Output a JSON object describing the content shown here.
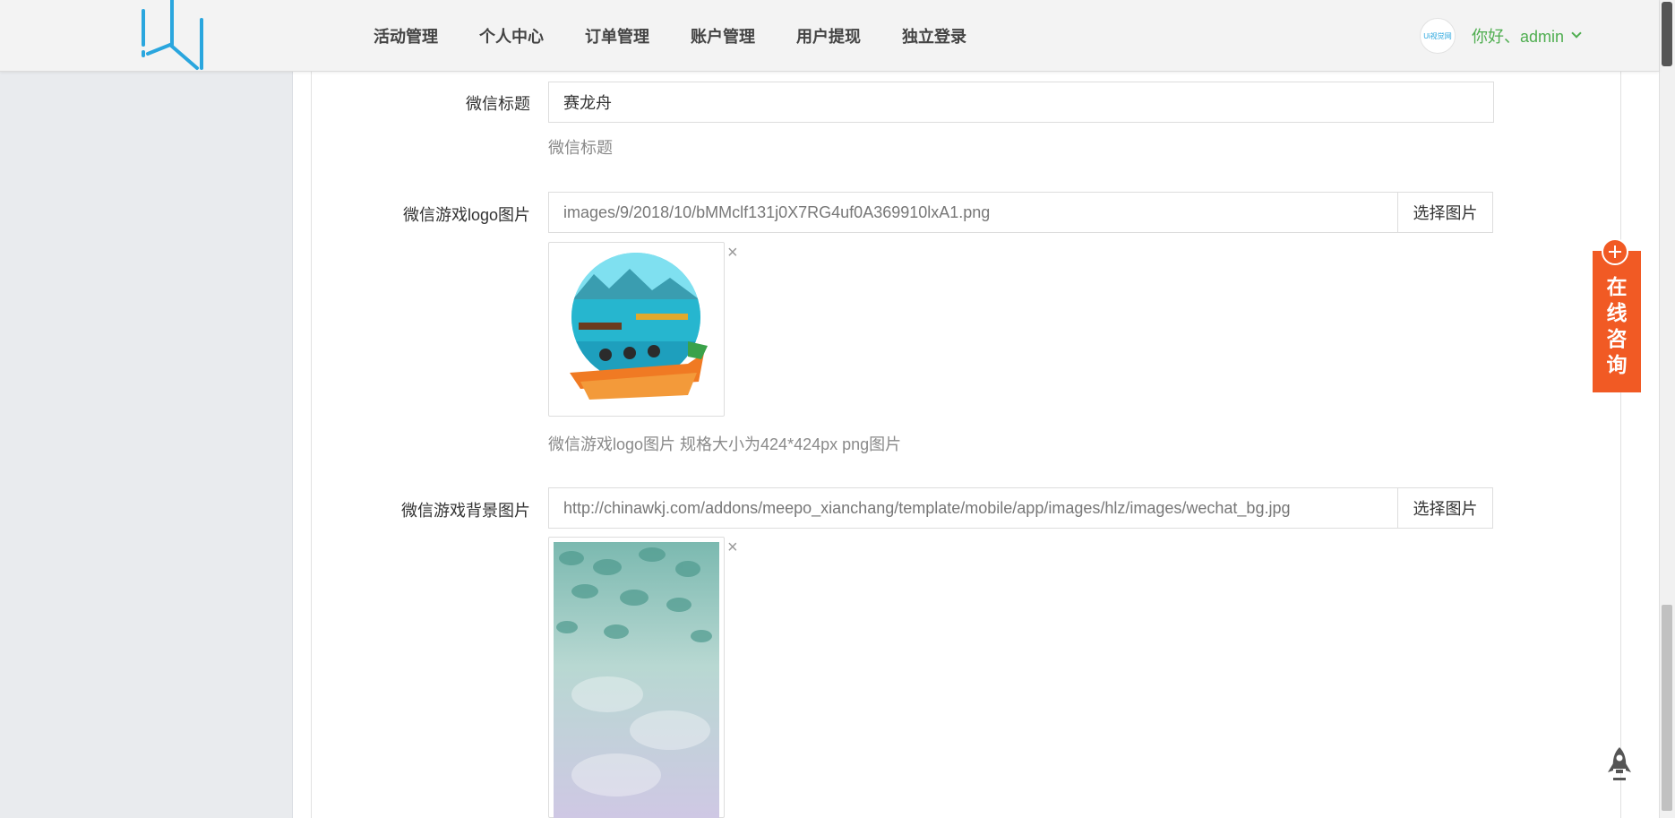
{
  "nav": {
    "items": [
      "活动管理",
      "个人中心",
      "订单管理",
      "账户管理",
      "用户提现",
      "独立登录"
    ]
  },
  "user": {
    "avatar_text": "Ui视觉网",
    "greeting": "你好、admin"
  },
  "form": {
    "title_field": {
      "label": "微信标题",
      "value": "赛龙舟",
      "help": "微信标题"
    },
    "logo_field": {
      "label": "微信游戏logo图片",
      "value": "images/9/2018/10/bMMclf131j0X7RG4uf0A369910lxA1.png",
      "button": "选择图片",
      "remove": "×",
      "help": "微信游戏logo图片 规格大小为424*424px png图片"
    },
    "bg_field": {
      "label": "微信游戏背景图片",
      "value": "http://chinawkj.com/addons/meepo_xianchang/template/mobile/app/images/hlz/images/wechat_bg.jpg",
      "button": "选择图片",
      "remove": "×"
    }
  },
  "consult": {
    "chars": [
      "在",
      "线",
      "咨",
      "询"
    ]
  },
  "colors": {
    "accent": "#2aa6de",
    "greeting": "#4fae50",
    "consult": "#f15a24"
  },
  "icons": [
    "logo-icon",
    "chevron-down-icon",
    "close-icon",
    "plus-circle-icon",
    "rocket-icon"
  ]
}
